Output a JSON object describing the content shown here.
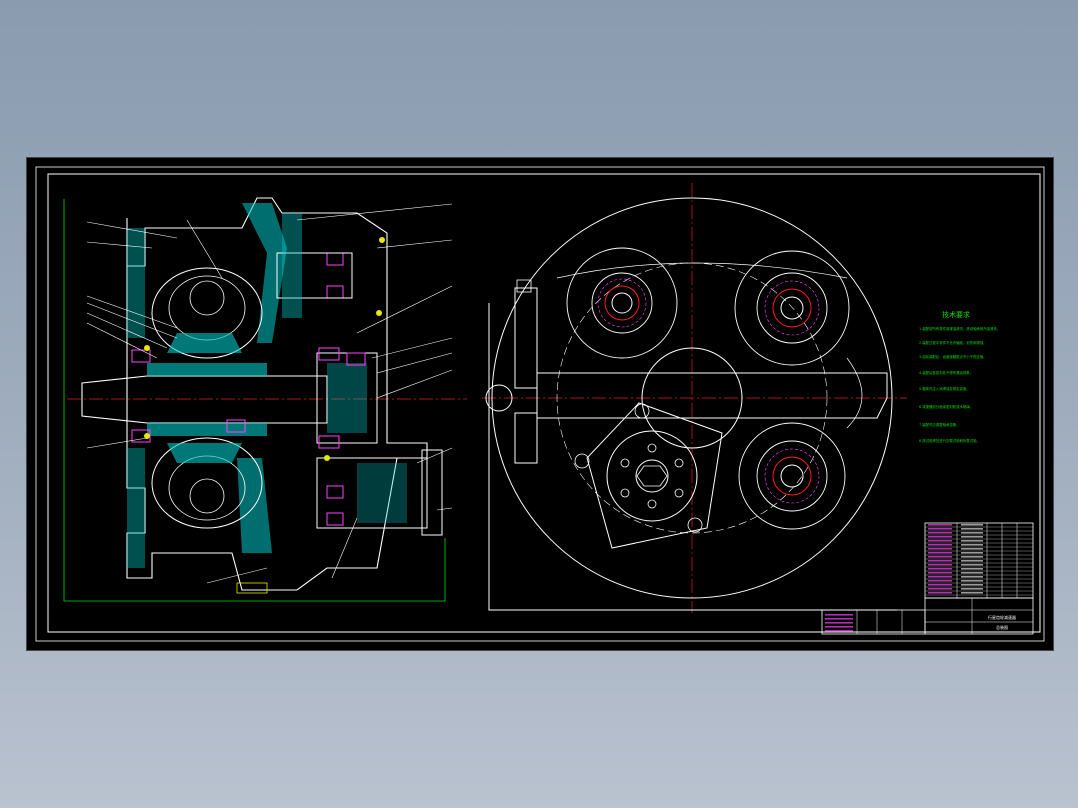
{
  "viewer": {
    "background_top": "#8a9bb0",
    "background_bottom": "#b9c2cf"
  },
  "drawing": {
    "sheet_color": "#000000",
    "colors": {
      "border": "#ffffff",
      "outline": "#ffffff",
      "hatch": "#00c8c8",
      "centerline": "#e02020",
      "green": "#00e000",
      "magenta": "#ff40ff",
      "yellow": "#e8e800",
      "red": "#ff2020"
    },
    "tech_title": "技术要求",
    "tech_notes": [
      "1.装配前所有零件用煤油清洗，滚动轴承用汽油清洗。",
      "2.装配过程中零件不允许磕碰、划伤和锈蚀。",
      "3.齿轮装配后，齿面接触斑点不小于规定值。",
      "4.装配后各密封处不得有漏油现象。",
      "5.箱体内注入润滑油至规定高度。",
      "6.减速器剖分面涂密封胶或水玻璃。",
      "7.装配时应调整轴承游隙。",
      "8.按试验规范进行空载试验和负载试验。"
    ],
    "title_block": {
      "name": "行星齿轮减速器",
      "drawing_no": "总装图"
    }
  }
}
